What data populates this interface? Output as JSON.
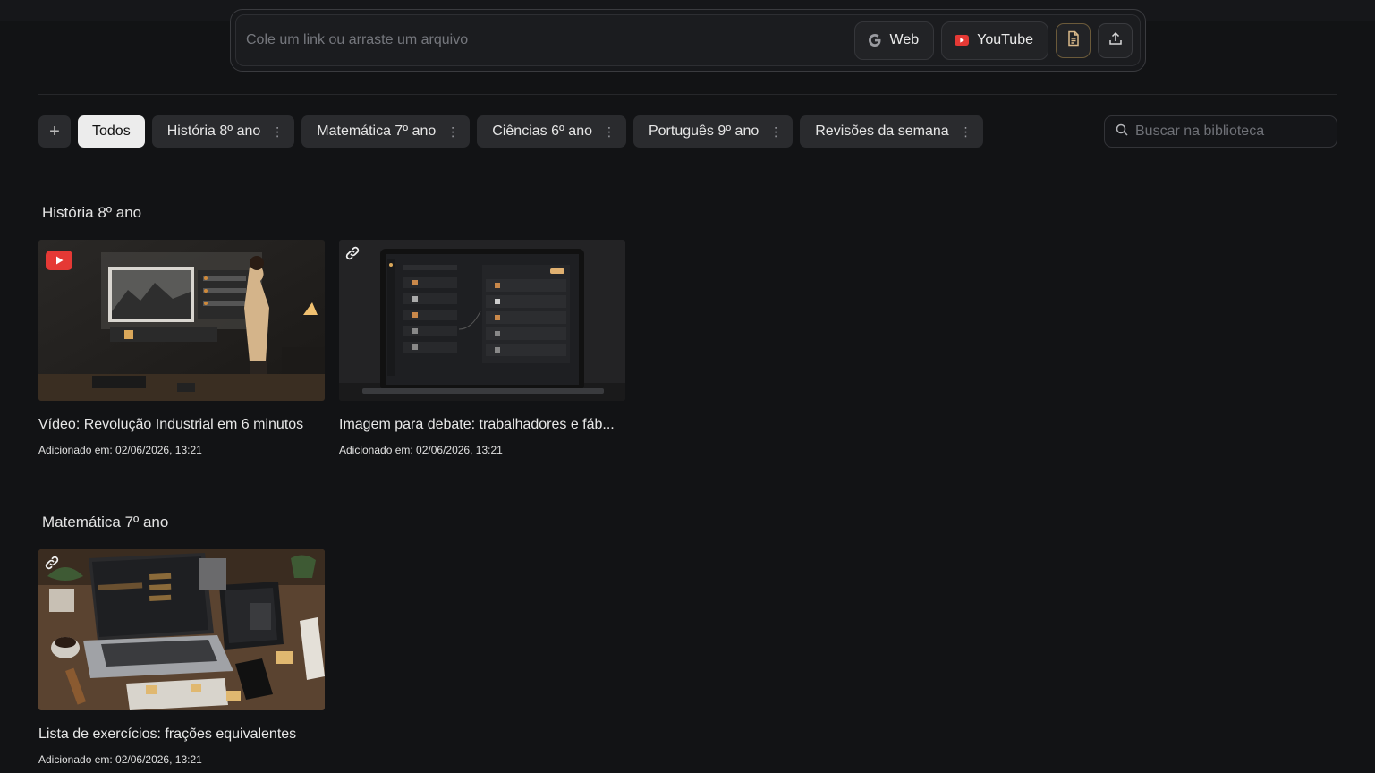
{
  "input_bar": {
    "placeholder": "Cole um link ou arraste um arquivo",
    "web_label": "Web",
    "youtube_label": "YouTube"
  },
  "filters": {
    "add_label": "+",
    "items": [
      {
        "label": "Todos",
        "active": true
      },
      {
        "label": "História 8º ano",
        "active": false
      },
      {
        "label": "Matemática 7º ano",
        "active": false
      },
      {
        "label": "Ciências 6º ano",
        "active": false
      },
      {
        "label": "Português 9º ano",
        "active": false
      },
      {
        "label": "Revisões da semana",
        "active": false
      }
    ],
    "search_placeholder": "Buscar na biblioteca"
  },
  "sections": [
    {
      "title": "História 8º ano",
      "cards": [
        {
          "type": "youtube",
          "icon": "youtube-icon",
          "title": "Vídeo: Revolução Industrial em 6 minutos",
          "date": "Adicionado em: 02/06/2026, 13:21"
        },
        {
          "type": "link",
          "icon": "link-icon",
          "title": "Imagem para debate: trabalhadores e fáb...",
          "date": "Adicionado em: 02/06/2026, 13:21"
        }
      ]
    },
    {
      "title": "Matemática 7º ano",
      "cards": [
        {
          "type": "link",
          "icon": "link-icon",
          "title": "Lista de exercícios: frações equivalentes",
          "date": "Adicionado em: 02/06/2026, 13:21"
        }
      ]
    }
  ],
  "colors": {
    "background": "#121315",
    "chip": "#2a2b2e",
    "chip_active": "#ececec",
    "youtube_red": "#e53935",
    "accent_doc": "#d9b98a"
  }
}
